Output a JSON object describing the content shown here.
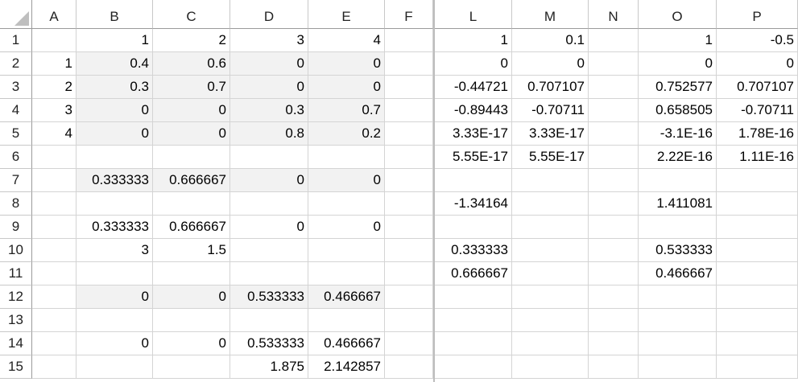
{
  "columns": [
    "A",
    "B",
    "C",
    "D",
    "E",
    "F",
    "L",
    "M",
    "N",
    "O",
    "P"
  ],
  "rows": [
    "1",
    "2",
    "3",
    "4",
    "5",
    "6",
    "7",
    "8",
    "9",
    "10",
    "11",
    "12",
    "13",
    "14",
    "15"
  ],
  "cells": {
    "B1": "1",
    "C1": "2",
    "D1": "3",
    "E1": "4",
    "L1": "1",
    "M1": "0.1",
    "O1": "1",
    "P1": "-0.5",
    "A2": "1",
    "B2": "0.4",
    "C2": "0.6",
    "D2": "0",
    "E2": "0",
    "L2": "0",
    "M2": "0",
    "O2": "0",
    "P2": "0",
    "A3": "2",
    "B3": "0.3",
    "C3": "0.7",
    "D3": "0",
    "E3": "0",
    "L3": "-0.44721",
    "M3": "0.707107",
    "O3": "0.752577",
    "P3": "0.707107",
    "A4": "3",
    "B4": "0",
    "C4": "0",
    "D4": "0.3",
    "E4": "0.7",
    "L4": "-0.89443",
    "M4": "-0.70711",
    "O4": "0.658505",
    "P4": "-0.70711",
    "A5": "4",
    "B5": "0",
    "C5": "0",
    "D5": "0.8",
    "E5": "0.2",
    "L5": "3.33E-17",
    "M5": "3.33E-17",
    "O5": "-3.1E-16",
    "P5": "1.78E-16",
    "L6": "5.55E-17",
    "M6": "5.55E-17",
    "O6": "2.22E-16",
    "P6": "1.11E-16",
    "B7": "0.333333",
    "C7": "0.666667",
    "D7": "0",
    "E7": "0",
    "L8": "-1.34164",
    "O8": "1.411081",
    "B9": "0.333333",
    "C9": "0.666667",
    "D9": "0",
    "E9": "0",
    "B10": "3",
    "C10": "1.5",
    "L10": "0.333333",
    "O10": "0.533333",
    "L11": "0.666667",
    "O11": "0.466667",
    "B12": "0",
    "C12": "0",
    "D12": "0.533333",
    "E12": "0.466667",
    "B14": "0",
    "C14": "0",
    "D14": "0.533333",
    "E14": "0.466667",
    "D15": "1.875",
    "E15": "2.142857"
  },
  "shaded_cells": [
    "B2",
    "C2",
    "D2",
    "E2",
    "B3",
    "C3",
    "D3",
    "E3",
    "B4",
    "C4",
    "D4",
    "E4",
    "B5",
    "C5",
    "D5",
    "E5",
    "B7",
    "C7",
    "D7",
    "E7",
    "B12",
    "C12",
    "D12",
    "E12"
  ],
  "colors": {
    "shade": "#f2f2f2",
    "gridline": "#d4d4d4",
    "header_border": "#9b9b9b"
  }
}
